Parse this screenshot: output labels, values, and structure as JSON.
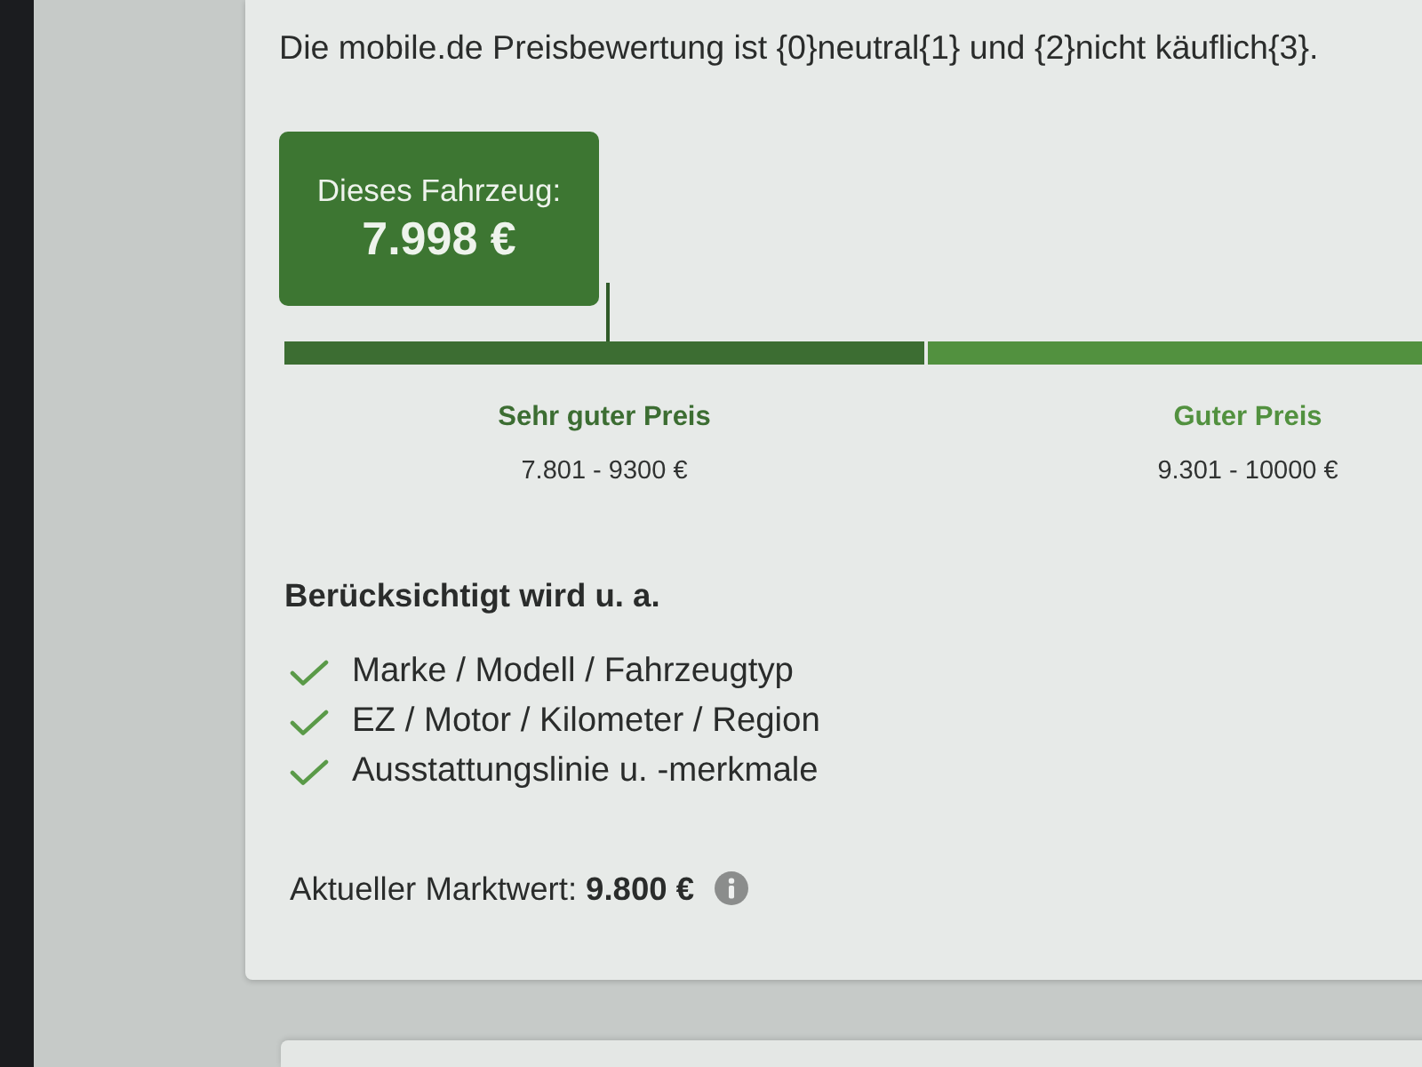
{
  "rating_note": "Die mobile.de Preisbewertung ist {0}neutral{1} und {2}nicht käuflich{3}.",
  "vehicle_price": {
    "label": "Dieses Fahrzeug:",
    "value": "7.998 €"
  },
  "price_ranges": [
    {
      "label": "Sehr guter Preis",
      "range": "7.801 - 9300 €",
      "color": "#3c6d32"
    },
    {
      "label": "Guter Preis",
      "range": "9.301 - 10000 €",
      "color": "#52913f"
    }
  ],
  "criteria": {
    "heading": "Berücksichtigt wird u. a.",
    "items": [
      "Marke / Modell / Fahrzeugtyp",
      "EZ / Motor / Kilometer / Region",
      "Ausstattungslinie u. -merkmale"
    ]
  },
  "market_value": {
    "label": "Aktueller Marktwert:",
    "value": "9.800 €"
  }
}
